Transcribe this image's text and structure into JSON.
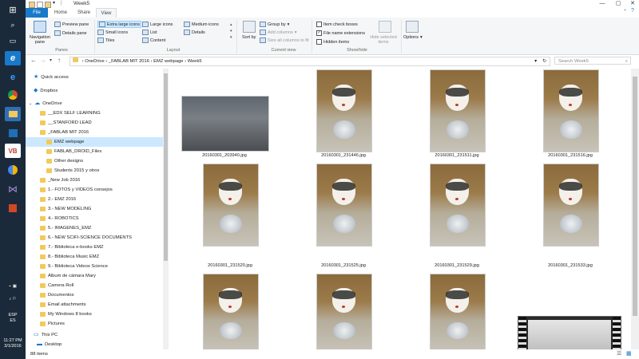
{
  "window": {
    "title": "Week5"
  },
  "taskbar": {
    "lang": "ESP",
    "lang_sub": "ES",
    "time": "11:27 PM",
    "date": "3/1/2016"
  },
  "ribbon": {
    "tabs": [
      "File",
      "Home",
      "Share",
      "View"
    ],
    "panes": {
      "navigation_pane": "Navigation pane",
      "preview_pane": "Preview pane",
      "details_pane": "Details pane",
      "group": "Panes"
    },
    "layout": {
      "items": [
        "Extra large icons",
        "Large icons",
        "Medium icons",
        "Small icons",
        "List",
        "Details",
        "Tiles",
        "Content"
      ],
      "group": "Layout"
    },
    "current_view": {
      "sort_by": "Sort by",
      "group_by": "Group by",
      "add_columns": "Add columns",
      "size_all_columns": "Size all columns to fit",
      "group": "Current view"
    },
    "show_hide": {
      "item_check_boxes": "Item check boxes",
      "file_name_extensions": "File name extensions",
      "hidden_items": "Hidden items",
      "hide_selected": "Hide selected items",
      "group": "Show/hide"
    },
    "options": "Options"
  },
  "address": {
    "crumbs": [
      "OneDrive",
      "_FABLAB MIT 2016",
      "EMZ webpage",
      "Week5"
    ],
    "search_placeholder": "Search Week5"
  },
  "nav": {
    "quick_access": "Quick access",
    "dropbox": "Dropbox",
    "onedrive": "OneDrive",
    "folders": [
      "__EDX SELF LEARNING",
      "__STANFORD LEAD",
      "_FABLAB MIT 2016",
      "EMZ webpage",
      "FABLAB_DROID_Files",
      "Other designs",
      "Students 2015 y otros",
      "_New Job 2016",
      "1.- FOTOS y VIDEOS consejos",
      "2.- EMZ 2016",
      "3.- NEW MODELING",
      "4.- ROBOTICS",
      "5.- IMAGENES_EMZ",
      "6.- NEW SCIFI-SCIENCE DOCUMENTS",
      "7.- Biblioteca e-books EMZ",
      "8.- Biblioteca Music EMZ",
      "9.- Biblioteca Videos Science",
      "Álbum de cámara Mary",
      "Camera Roll",
      "Documentos",
      "Email attachments",
      "My Windows 8 books",
      "Pictures"
    ],
    "this_pc": "This PC",
    "desktop": "Desktop"
  },
  "files": [
    "20160301_203940.jpg",
    "20160301_231446.jpg",
    "20160301_231511.jpg",
    "20160301_231516.jpg",
    "20160301_231520.jpg",
    "20160301_231525.jpg",
    "20160301_231529.jpg",
    "20160301_231533.jpg"
  ],
  "status": {
    "item_count": "88 items"
  }
}
